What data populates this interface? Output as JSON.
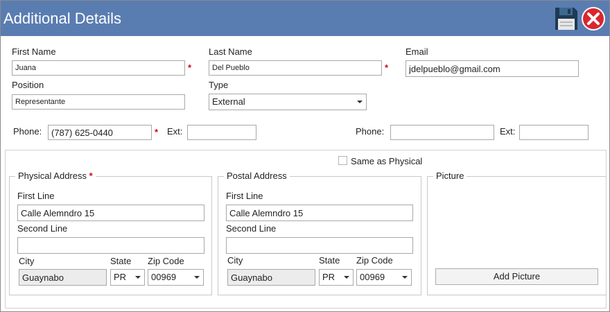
{
  "window": {
    "title": "Additional Details"
  },
  "icons": {
    "save": "floppy-disk-icon",
    "close": "close-icon"
  },
  "colors": {
    "titlebar": "#5a7db1",
    "required": "#d0021b",
    "close": "#d9272e"
  },
  "form": {
    "first_name": {
      "label": "First Name",
      "value": "Juana",
      "required": "*"
    },
    "last_name": {
      "label": "Last Name",
      "value": "Del Pueblo",
      "required": "*"
    },
    "email": {
      "label": "Email",
      "value": "jdelpueblo@gmail.com"
    },
    "position": {
      "label": "Position",
      "value": "Representante"
    },
    "type": {
      "label": "Type",
      "value": "External"
    },
    "phone1": {
      "label": "Phone:",
      "value": "(787) 625-0440",
      "required": "*",
      "ext_label": "Ext:",
      "ext_value": ""
    },
    "phone2": {
      "label": "Phone:",
      "value": "",
      "ext_label": "Ext:",
      "ext_value": ""
    }
  },
  "same_as_physical": {
    "label": "Same as Physical",
    "checked": false
  },
  "physical": {
    "title": "Physical Address",
    "required": "*",
    "first_line_label": "First Line",
    "first_line": "Calle Alemndro 15",
    "second_line_label": "Second Line",
    "second_line": "",
    "city_label": "City",
    "city": "Guaynabo",
    "state_label": "State",
    "state": "PR",
    "zip_label": "Zip Code",
    "zip": "00969"
  },
  "postal": {
    "title": "Postal Address",
    "first_line_label": "First Line",
    "first_line": "Calle Alemndro 15",
    "second_line_label": "Second Line",
    "second_line": "",
    "city_label": "City",
    "city": "Guaynabo",
    "state_label": "State",
    "state": "PR",
    "zip_label": "Zip Code",
    "zip": "00969"
  },
  "picture": {
    "title": "Picture",
    "add_button": "Add Picture"
  }
}
